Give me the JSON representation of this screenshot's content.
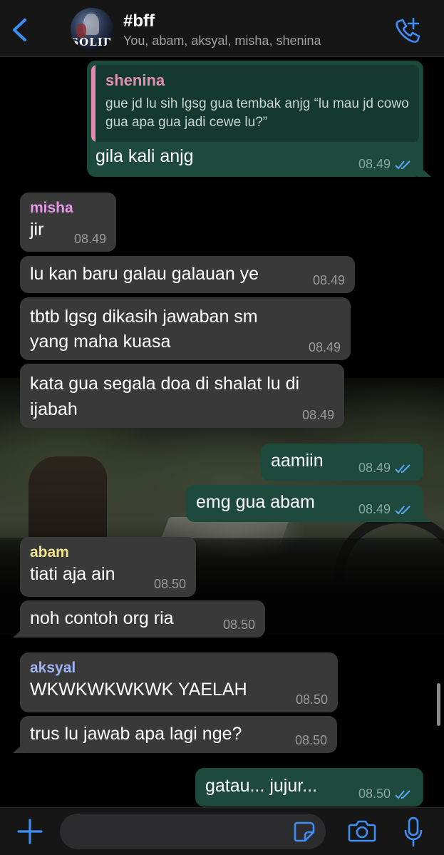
{
  "header": {
    "title": "#bff",
    "participants": "You, abam, aksyal, misha, shenina",
    "avatar_text": "SOLID",
    "back_icon": "chevron-left-icon",
    "call_icon": "phone-plus-icon"
  },
  "colors": {
    "accent": "#3e8ef7",
    "incoming_bubble": "#393939",
    "outgoing_bubble": "#1d4a3d",
    "name_shenina": "#e28fb4",
    "name_misha": "#e59ae8",
    "name_abam": "#f3e38c",
    "name_aksyal": "#9fb2f5",
    "read_ticks": "#5aa8f5"
  },
  "messages": [
    {
      "direction": "out",
      "quote_sender": "shenina",
      "quote_text": "gue jd lu sih lgsg gua tembak anjg “lu mau jd cowo gua apa gua jadi cewe lu?”",
      "text": "gila kali anjg",
      "time": "08.49",
      "status": "read"
    },
    {
      "direction": "in",
      "sender": "misha",
      "text": "jir",
      "time": "08.49"
    },
    {
      "direction": "in",
      "text": "lu kan baru galau galauan ye",
      "time": "08.49"
    },
    {
      "direction": "in",
      "text": "tbtb lgsg dikasih jawaban sm yang maha kuasa",
      "time": "08.49"
    },
    {
      "direction": "in",
      "text": "kata gua segala doa di shalat lu di ijabah",
      "time": "08.49"
    },
    {
      "direction": "out",
      "text": "aamiin",
      "time": "08.49",
      "status": "read"
    },
    {
      "direction": "out",
      "text": "emg gua abam",
      "time": "08.49",
      "status": "read"
    },
    {
      "direction": "in",
      "sender": "abam",
      "text": "tiati aja ain",
      "time": "08.50"
    },
    {
      "direction": "in",
      "text": "noh contoh org ria",
      "time": "08.50"
    },
    {
      "direction": "in",
      "sender": "aksyal",
      "text": "WKWKWKWKWK YAELAH",
      "time": "08.50"
    },
    {
      "direction": "in",
      "text": "trus lu jawab apa lagi nge?",
      "time": "08.50"
    },
    {
      "direction": "out",
      "text": "gatau... jujur...",
      "time": "08.50",
      "status": "read"
    }
  ],
  "input": {
    "placeholder": "",
    "plus_icon": "plus-icon",
    "sticker_icon": "sticker-icon",
    "camera_icon": "camera-icon",
    "mic_icon": "microphone-icon"
  }
}
